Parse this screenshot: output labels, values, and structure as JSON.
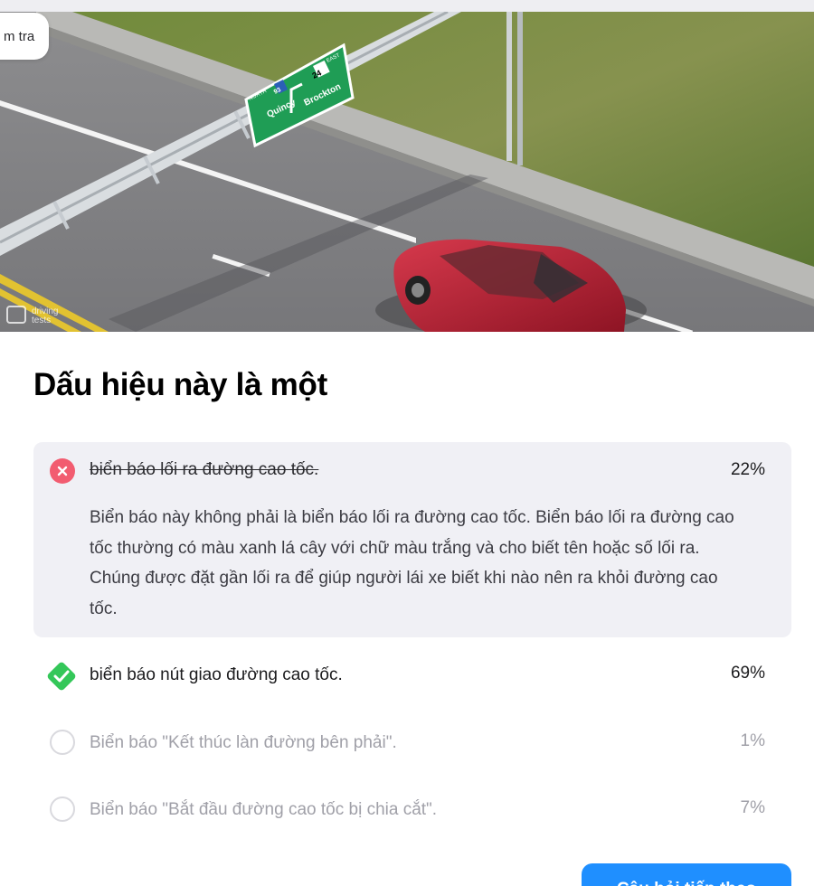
{
  "header": {
    "chip_label": "m tra"
  },
  "hero": {
    "watermark": "driving\ntests",
    "sign": {
      "direction": "NORTH",
      "route_shield": "93",
      "east_label": "EAST",
      "east_shield": "24",
      "left_dest": "Quincy",
      "right_dest": "Brockton"
    }
  },
  "question": {
    "title": "Dấu hiệu này là một"
  },
  "answers": [
    {
      "label": "biển báo lối ra đường cao tốc.",
      "percent": "22%",
      "state": "wrong",
      "explanation": "Biển báo này không phải là biển báo lối ra đường cao tốc. Biển báo lối ra đường cao tốc thường có màu xanh lá cây với chữ màu trắng và cho biết tên hoặc số lối ra. Chúng được đặt gần lối ra để giúp người lái xe biết khi nào nên ra khỏi đường cao tốc."
    },
    {
      "label": "biển báo nút giao đường cao tốc.",
      "percent": "69%",
      "state": "correct"
    },
    {
      "label": "Biển báo \"Kết thúc làn đường bên phải\".",
      "percent": "1%",
      "state": "neutral"
    },
    {
      "label": "Biển báo \"Bắt đầu đường cao tốc bị chia cắt\".",
      "percent": "7%",
      "state": "neutral"
    }
  ],
  "footer": {
    "next_button_label": "Câu hỏi tiếp theo"
  },
  "colors": {
    "wrong": "#f25c70",
    "correct": "#34c759",
    "primary": "#1f8fff",
    "sign_green": "#1f9d55"
  }
}
